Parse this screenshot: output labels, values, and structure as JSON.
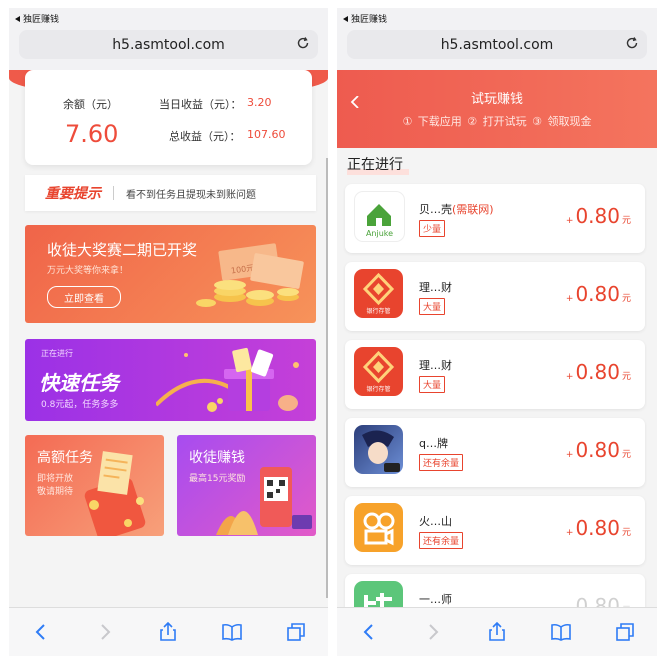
{
  "left": {
    "status": {
      "back_app": "独匠赚钱"
    },
    "url": "h5.asmtool.com",
    "balance": {
      "label": "余额（元）",
      "value": "7.60",
      "today_label": "当日收益（元）：",
      "today_value": "3.20",
      "total_label": "总收益（元）：",
      "total_value": "107.60"
    },
    "notice": {
      "tag": "重要提示",
      "text": "看不到任务且提现未到账问题"
    },
    "banner1": {
      "title": "收徒大奖赛二期已开奖",
      "subtitle": "万元大奖等你来拿！",
      "button": "立即查看",
      "bill_text": "100元"
    },
    "banner2": {
      "tag": "正在进行",
      "title": "快速任务",
      "subtitle": "0.8元起，任务多多"
    },
    "card_high": {
      "title": "高额任务",
      "subtitle": "即将开放 敬请期待"
    },
    "card_recruit": {
      "title": "收徒赚钱",
      "subtitle": "最高15元奖励"
    }
  },
  "right": {
    "status": {
      "back_app": "独匠赚钱"
    },
    "url": "h5.asmtool.com",
    "header": {
      "title": "试玩赚钱",
      "steps": "① 下载应用 ② 打开试玩 ③ 领取现金"
    },
    "section_title": "正在进行",
    "tasks": [
      {
        "name": "贝…壳",
        "highlight": "(需联网)",
        "tag": "少量",
        "plus": "+",
        "amount": "0.80",
        "unit": "元",
        "icon": "anjuke-house-icon",
        "icon_text": "Anjuke"
      },
      {
        "name": "理…财",
        "highlight": "",
        "tag": "大量",
        "plus": "+",
        "amount": "0.80",
        "unit": "元",
        "icon": "finance-diamond-icon",
        "icon_text": "银行存管"
      },
      {
        "name": "理…财",
        "highlight": "",
        "tag": "大量",
        "plus": "+",
        "amount": "0.80",
        "unit": "元",
        "icon": "finance-diamond-icon",
        "icon_text": "银行存管"
      },
      {
        "name": "q…牌",
        "highlight": "",
        "tag": "还有余量",
        "plus": "+",
        "amount": "0.80",
        "unit": "元",
        "icon": "game-character-icon",
        "icon_text": ""
      },
      {
        "name": "火…山",
        "highlight": "",
        "tag": "还有余量",
        "plus": "+",
        "amount": "0.80",
        "unit": "元",
        "icon": "video-camera-icon",
        "icon_text": ""
      },
      {
        "name": "一…师",
        "highlight": "",
        "tag": "",
        "plus": "+",
        "amount": "0.80",
        "unit": "元",
        "icon": "teacher-app-icon",
        "icon_text": ""
      }
    ]
  },
  "colors": {
    "accent": "#e8442e",
    "header": "#ee5b4f",
    "purple": "#9b31e6"
  }
}
